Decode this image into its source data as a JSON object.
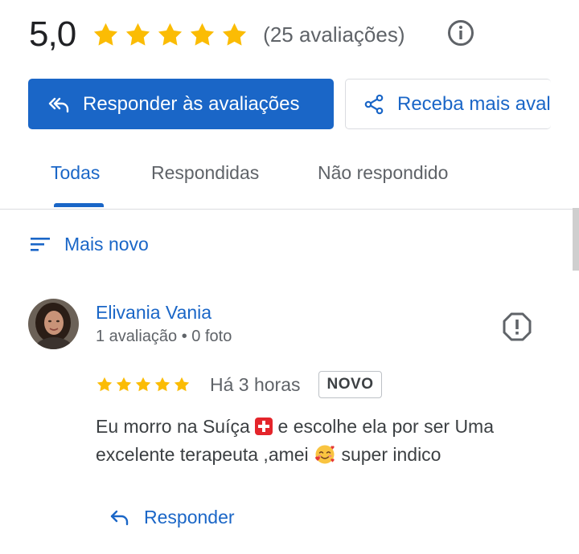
{
  "summary": {
    "rating": "5,0",
    "star_count": 5,
    "reviews_count": "(25 avaliações)"
  },
  "actions": {
    "reply_all_label": "Responder às avaliações",
    "share_label": "Receba mais avaliações"
  },
  "tabs": [
    {
      "label": "Todas",
      "active": true
    },
    {
      "label": "Respondidas",
      "active": false
    },
    {
      "label": "Não respondido",
      "active": false
    }
  ],
  "sort": {
    "label": "Mais novo"
  },
  "review": {
    "author": "Elivania Vania",
    "meta": "1 avaliação • 0 foto",
    "stars": 5,
    "time": "Há 3 horas",
    "badge": "NOVO",
    "text_part1": "Eu morro na Suíça ",
    "text_part2": " e escolhe ela por ser Uma excelente terapeuta ,amei ",
    "text_part3": " super indico",
    "reply_label": "Responder"
  },
  "colors": {
    "accent": "#1a66c7",
    "star": "#fbbc04",
    "text_secondary": "#5f6368"
  },
  "icons": [
    "star-icon",
    "info-icon",
    "reply-all-icon",
    "share-icon",
    "sort-icon",
    "report-icon",
    "reply-icon",
    "swiss-flag-emoji",
    "smiling-face-with-hearts-emoji"
  ]
}
